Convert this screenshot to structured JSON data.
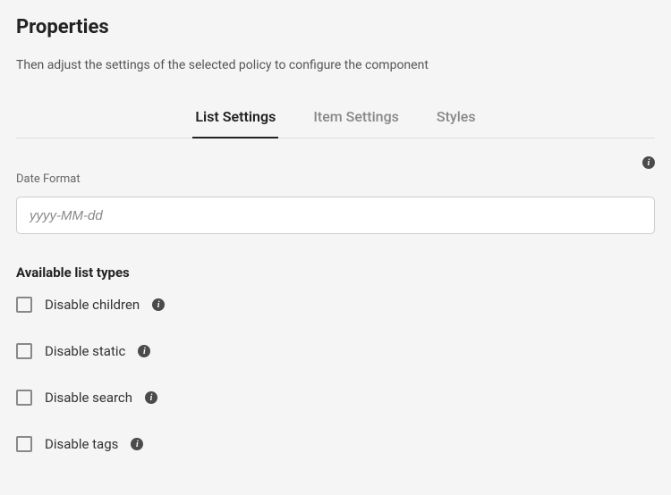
{
  "header": {
    "title": "Properties",
    "subtitle": "Then adjust the settings of the selected policy to configure the component"
  },
  "tabs": {
    "items": [
      {
        "label": "List Settings",
        "active": true
      },
      {
        "label": "Item Settings",
        "active": false
      },
      {
        "label": "Styles",
        "active": false
      }
    ]
  },
  "dateFormat": {
    "label": "Date Format",
    "placeholder": "yyyy-MM-dd",
    "value": ""
  },
  "listTypes": {
    "heading": "Available list types",
    "items": [
      {
        "label": "Disable children",
        "checked": false
      },
      {
        "label": "Disable static",
        "checked": false
      },
      {
        "label": "Disable search",
        "checked": false
      },
      {
        "label": "Disable tags",
        "checked": false
      }
    ]
  }
}
